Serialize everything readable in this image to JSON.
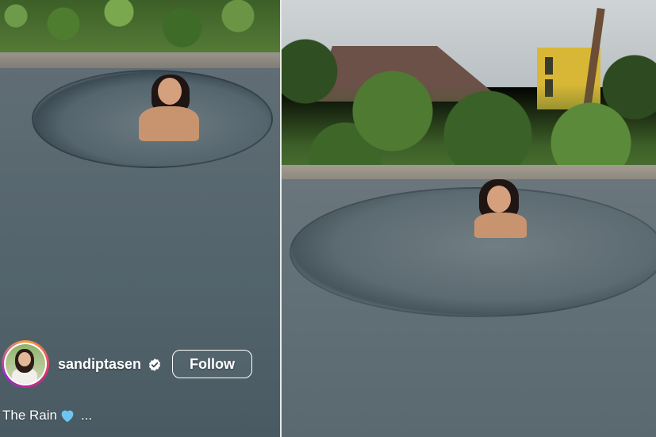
{
  "post": {
    "username": "sandiptasen",
    "follow_label": "Follow",
    "caption_text": "The Rain",
    "caption_more": "..."
  },
  "icons": {
    "verified": "verified-badge-icon",
    "caption_emoji": "light-blue-heart-icon"
  },
  "colors": {
    "heart": "#6ec6f0",
    "verified_fill": "#ffffff",
    "avatar_ring": [
      "#f9a03f",
      "#d62976",
      "#962fbf"
    ]
  }
}
